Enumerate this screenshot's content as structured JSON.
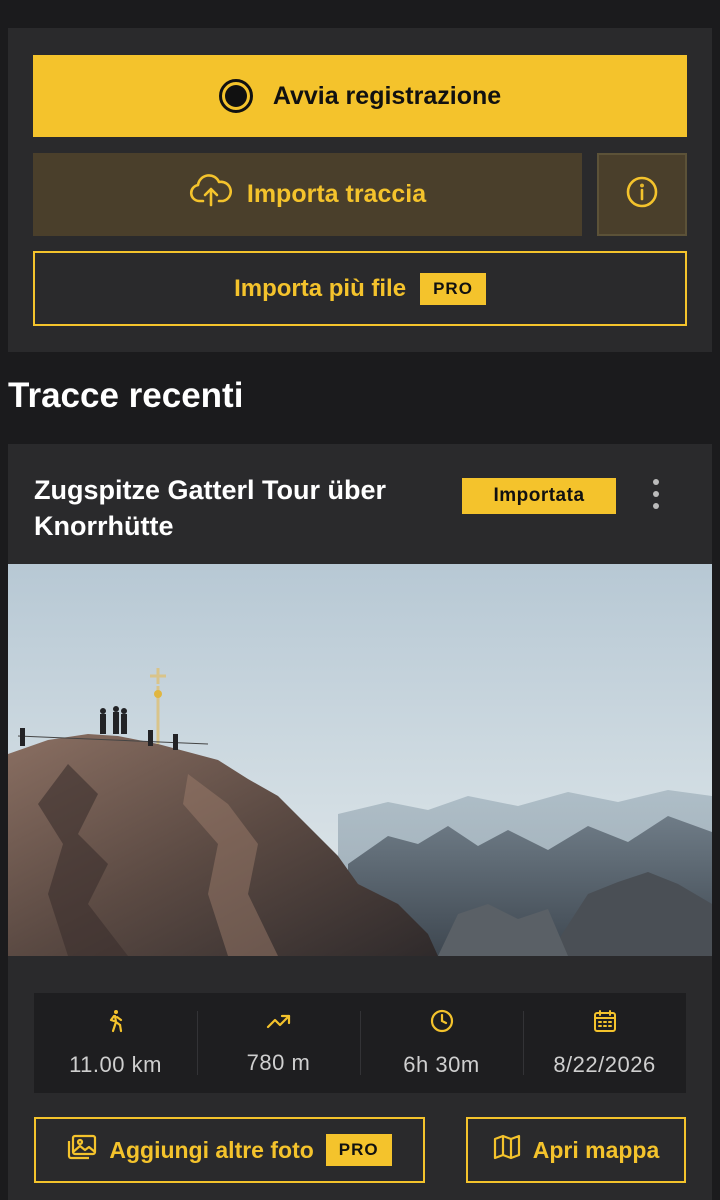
{
  "actions": {
    "record_label": "Avvia registrazione",
    "import_label": "Importa traccia",
    "import_multi_label": "Importa più file",
    "pro_badge": "PRO"
  },
  "recent": {
    "section_title": "Tracce recenti",
    "track": {
      "title": "Zugspitze Gatterl Tour über Knorrhütte",
      "status_badge": "Importata",
      "photo": "mountain-summit-cross-photo",
      "stats": {
        "distance": "11.00 km",
        "elevation_gain": "780 m",
        "duration": "6h 30m",
        "date": "8/22/2026"
      },
      "add_photos_label": "Aggiungi altre foto",
      "add_photos_badge": "PRO",
      "open_map_label": "Apri mappa"
    }
  },
  "icons": {
    "record": "record-icon",
    "upload": "cloud-upload-icon",
    "info": "info-icon",
    "more": "more-vertical-icon",
    "distance": "hiker-icon",
    "elevation": "trending-up-icon",
    "duration": "clock-icon",
    "date": "calendar-icon",
    "photos": "image-icon",
    "map": "map-icon"
  },
  "colors": {
    "accent": "#f4c32c",
    "background": "#1b1b1d",
    "surface": "#2a2a2c",
    "import_button": "#4a3f2b"
  }
}
